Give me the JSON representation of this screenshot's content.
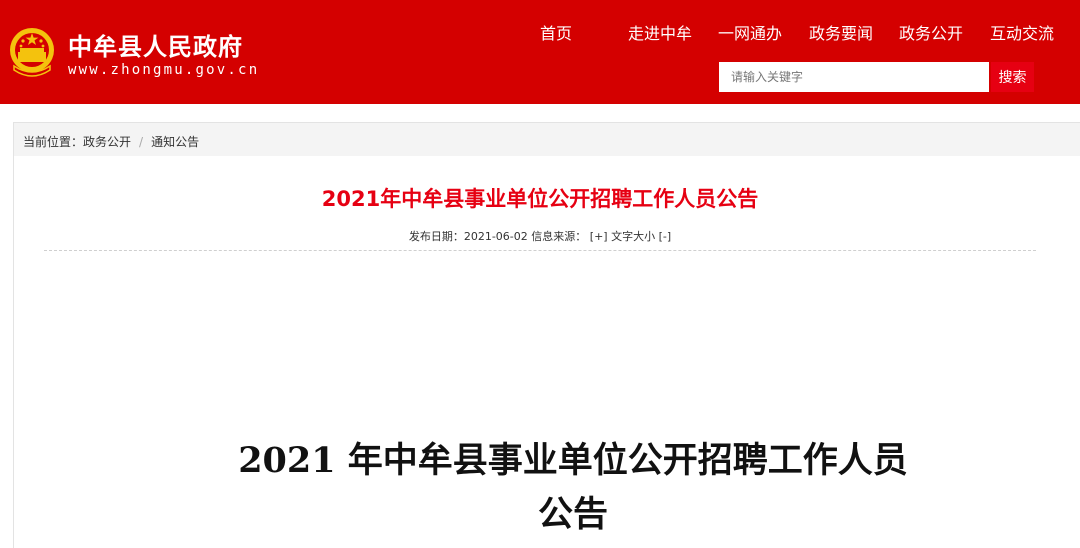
{
  "header": {
    "site_name": "中牟县人民政府",
    "site_url": "www.zhongmu.gov.cn",
    "emblem_icon": "national-emblem-icon",
    "brand_color": "#d40000"
  },
  "nav": {
    "items": [
      {
        "label": "首页"
      },
      {
        "label": "走进中牟"
      },
      {
        "label": "一网通办"
      },
      {
        "label": "政务要闻"
      },
      {
        "label": "政务公开"
      },
      {
        "label": "互动交流"
      }
    ]
  },
  "search": {
    "placeholder": "请输入关键字",
    "button_label": "搜索",
    "button_color": "#e60012"
  },
  "breadcrumb": {
    "prefix": "当前位置：",
    "items": [
      "政务公开",
      "通知公告"
    ],
    "separator": "/"
  },
  "article": {
    "title": "2021年中牟县事业单位公开招聘工作人员公告",
    "title_color": "#e60012",
    "meta": {
      "date_label": "发布日期：",
      "date": "2021-06-02",
      "source_label": "信息来源：",
      "font_larger": "[+]",
      "font_size_label": "文字大小",
      "font_smaller": "[-]"
    },
    "doc_title_line1": "2021 年中牟县事业单位公开招聘工作人员",
    "doc_title_line2": "公告"
  }
}
